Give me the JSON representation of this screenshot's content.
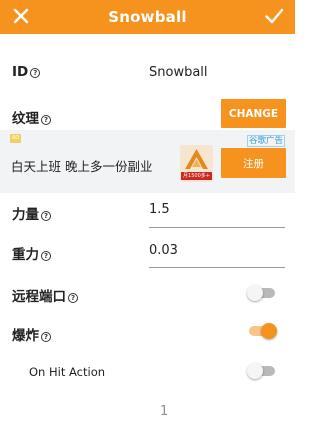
{
  "header": {
    "title": "Snowball",
    "close_icon": "close-icon",
    "confirm_icon": "check-icon",
    "color": "#f5931e"
  },
  "fields": {
    "id": {
      "label": "ID",
      "value": "Snowball"
    },
    "texture": {
      "label": "纹理",
      "button": "CHANGE"
    },
    "force": {
      "label": "力量",
      "value": "1.5"
    },
    "gravity": {
      "label": "重力",
      "value": "0.03"
    },
    "remote_port": {
      "label": "远程端口",
      "enabled": false
    },
    "explode": {
      "label": "爆炸",
      "enabled": true
    },
    "on_hit_action": {
      "label": "On Hit Action",
      "enabled": false
    },
    "partial_value": "1"
  },
  "ad": {
    "text": "白天上班 晚上多一份副业",
    "badge": "谷歌广告",
    "thumb_caption": "月1500多+",
    "button": "注册"
  },
  "colors": {
    "accent": "#f5931e",
    "toggle_off": "#b9b9b9"
  }
}
